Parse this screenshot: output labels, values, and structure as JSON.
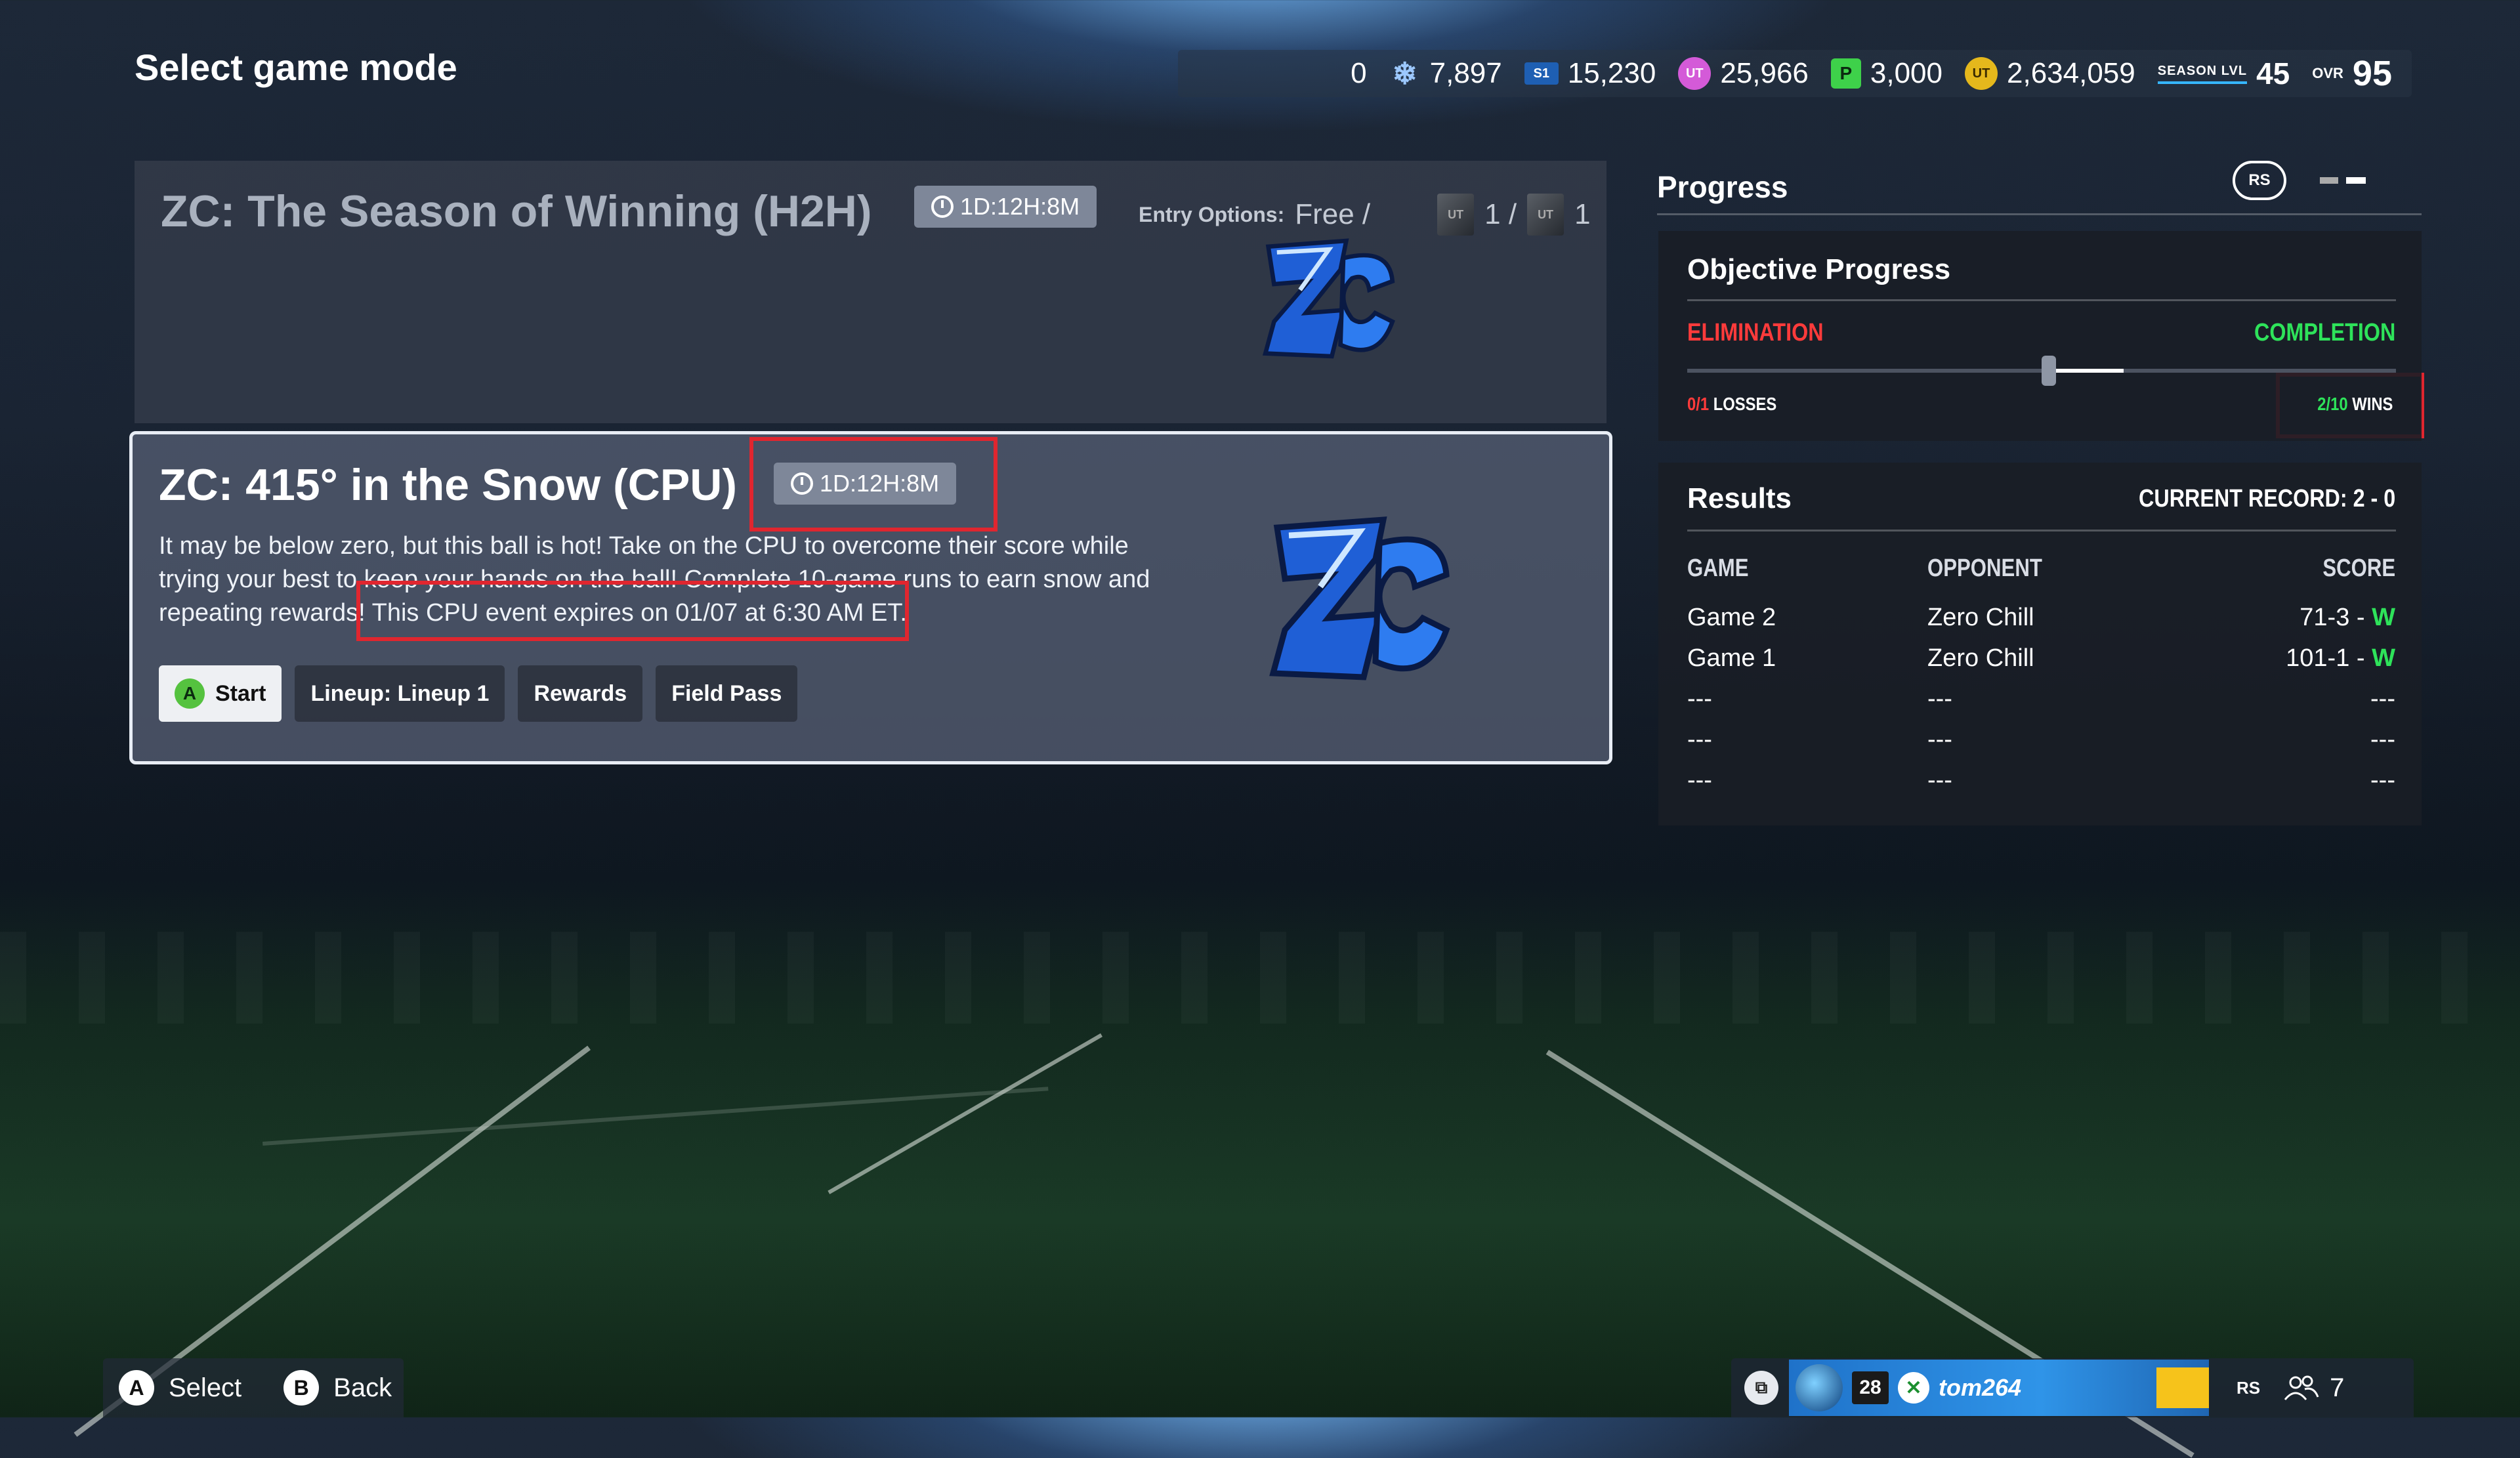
{
  "header": {
    "title": "Select game mode",
    "currencies": [
      {
        "icon": "none",
        "value": "0"
      },
      {
        "icon": "snowflake-icon",
        "value": "7,897"
      },
      {
        "icon": "s1-icon",
        "value": "15,230"
      },
      {
        "icon": "ut-points-pink-icon",
        "value": "25,966"
      },
      {
        "icon": "p-points-icon",
        "value": "3,000"
      },
      {
        "icon": "ut-coins-gold-icon",
        "value": "2,634,059"
      }
    ],
    "season_label": "SEASON LVL",
    "season_level": "45",
    "ovr_label": "OVR",
    "ovr_value": "95"
  },
  "modes": [
    {
      "title": "ZC: The Season of Winning (H2H)",
      "timer": "1D:12H:8M",
      "entry_label": "Entry Options:",
      "entry_free": "Free /",
      "token_count_1": "1 /",
      "token_count_2": "1",
      "logo_text": "ZC"
    },
    {
      "title": "ZC: 415° in the Snow (CPU)",
      "timer": "1D:12H:8M",
      "description_1": "It may be below zero, but this ball is hot! Take on the CPU to overcome their score while trying your best to keep your hands on the ball! Complete 10-game runs to earn snow and repeating rewards!",
      "description_2": " This CPU event expires on 01/07 at 6:30 AM ET.",
      "buttons": {
        "start_key": "A",
        "start": "Start",
        "lineup": "Lineup: Lineup 1",
        "rewards": "Rewards",
        "field_pass": "Field Pass"
      },
      "logo_text": "ZC"
    }
  ],
  "progress": {
    "title": "Progress",
    "rs_label": "RS",
    "objective": {
      "title": "Objective Progress",
      "left_label": "ELIMINATION",
      "right_label": "COMPLETION",
      "losses_value": "0/1",
      "losses_label": "LOSSES",
      "wins_value": "2/10",
      "wins_label": "WINS",
      "wins_fraction": 0.2
    },
    "results": {
      "title": "Results",
      "record": "CURRENT RECORD: 2 - 0",
      "headers": {
        "game": "GAME",
        "opponent": "OPPONENT",
        "score": "SCORE"
      },
      "rows": [
        {
          "game": "Game 2",
          "opponent": "Zero Chill",
          "score": "71-3",
          "sep": "-",
          "result": "W"
        },
        {
          "game": "Game 1",
          "opponent": "Zero Chill",
          "score": "101-1",
          "sep": "-",
          "result": "W"
        },
        {
          "game": "---",
          "opponent": "---",
          "score": "---",
          "sep": "",
          "result": ""
        },
        {
          "game": "---",
          "opponent": "---",
          "score": "---",
          "sep": "",
          "result": ""
        },
        {
          "game": "---",
          "opponent": "---",
          "score": "---",
          "sep": "",
          "result": ""
        }
      ]
    }
  },
  "footer": {
    "select_key": "A",
    "select": "Select",
    "back_key": "B",
    "back": "Back",
    "ovr_badge": "28",
    "gamertag": "tom264",
    "rs_label": "RS",
    "friends_count": "7"
  },
  "colors": {
    "elimination": "#ff3b3b",
    "completion": "#2ee35a",
    "highlight_box": "#e0262f"
  }
}
